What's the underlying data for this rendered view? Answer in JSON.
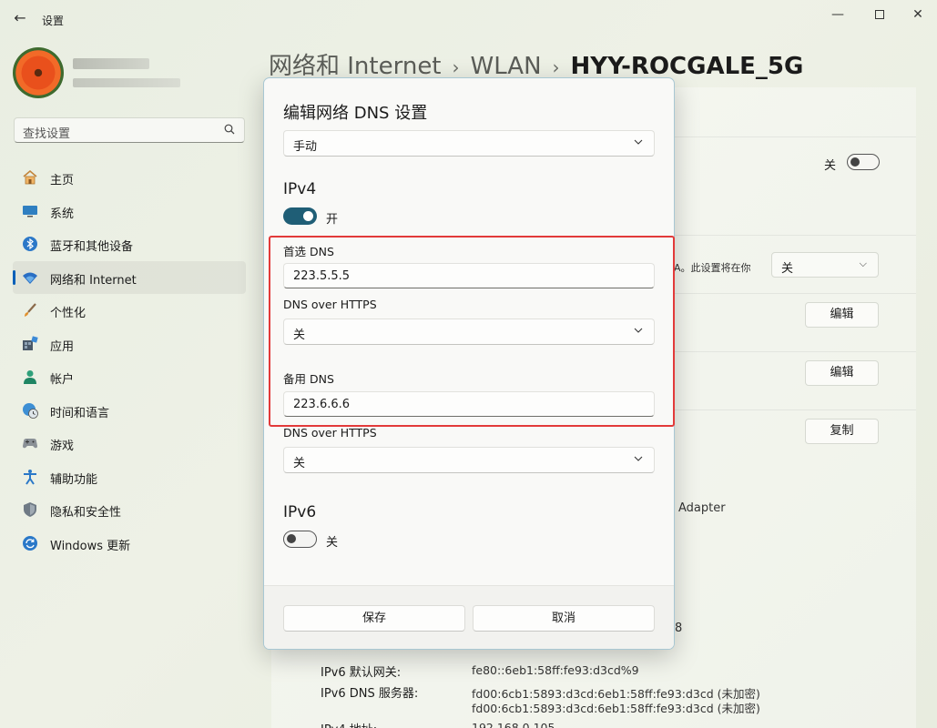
{
  "window": {
    "title": "设置",
    "back_glyph": "←",
    "minimize_glyph": "—",
    "close_glyph": "✕"
  },
  "sidebar": {
    "search_placeholder": "查找设置",
    "items": [
      {
        "label": "主页",
        "icon": "home-icon",
        "active": false
      },
      {
        "label": "系统",
        "icon": "monitor-icon",
        "active": false
      },
      {
        "label": "蓝牙和其他设备",
        "icon": "bluetooth-icon",
        "active": false
      },
      {
        "label": "网络和 Internet",
        "icon": "wifi-icon",
        "active": true
      },
      {
        "label": "个性化",
        "icon": "brush-icon",
        "active": false
      },
      {
        "label": "应用",
        "icon": "apps-icon",
        "active": false
      },
      {
        "label": "帐户",
        "icon": "person-icon",
        "active": false
      },
      {
        "label": "时间和语言",
        "icon": "globe-clock-icon",
        "active": false
      },
      {
        "label": "游戏",
        "icon": "gamepad-icon",
        "active": false
      },
      {
        "label": "辅助功能",
        "icon": "accessibility-icon",
        "active": false
      },
      {
        "label": "隐私和安全性",
        "icon": "shield-icon",
        "active": false
      },
      {
        "label": "Windows 更新",
        "icon": "update-icon",
        "active": false
      }
    ]
  },
  "breadcrumb": {
    "items": [
      "网络和 Internet",
      "WLAN",
      "HYY-ROCGALE_5G"
    ],
    "separator": "›"
  },
  "background": {
    "toggle_label": "关",
    "note_text": "A。此设置将在你",
    "select_value": "关",
    "buttons": [
      "编辑",
      "编辑",
      "复制"
    ],
    "adapter_text": "Adapter",
    "fragment_text": "8",
    "properties": [
      {
        "label": "IPv6 默认网关:",
        "value": "fe80::6eb1:58ff:fe93:d3cd%9"
      },
      {
        "label": "IPv6 DNS 服务器:",
        "value": "fd00:6cb1:5893:d3cd:6eb1:58ff:fe93:d3cd (未加密)",
        "value2": "fd00:6cb1:5893:d3cd:6eb1:58ff:fe93:d3cd (未加密)"
      },
      {
        "label": "IPv4 地址:",
        "value": "192.168.0.105"
      }
    ]
  },
  "dialog": {
    "title": "编辑网络 DNS 设置",
    "mode_value": "手动",
    "ipv4": {
      "heading": "IPv4",
      "toggle_label": "开",
      "preferred_label": "首选 DNS",
      "preferred_value": "223.5.5.5",
      "doh1_label": "DNS over HTTPS",
      "doh1_value": "关",
      "alternate_label": "备用 DNS",
      "alternate_value": "223.6.6.6",
      "doh2_label": "DNS over HTTPS",
      "doh2_value": "关"
    },
    "ipv6": {
      "heading": "IPv6",
      "toggle_label": "关"
    },
    "save_label": "保存",
    "cancel_label": "取消"
  },
  "colors": {
    "accent": "#1f5e76",
    "highlight": "#e23a3a",
    "nav_indicator": "#005fb8"
  }
}
